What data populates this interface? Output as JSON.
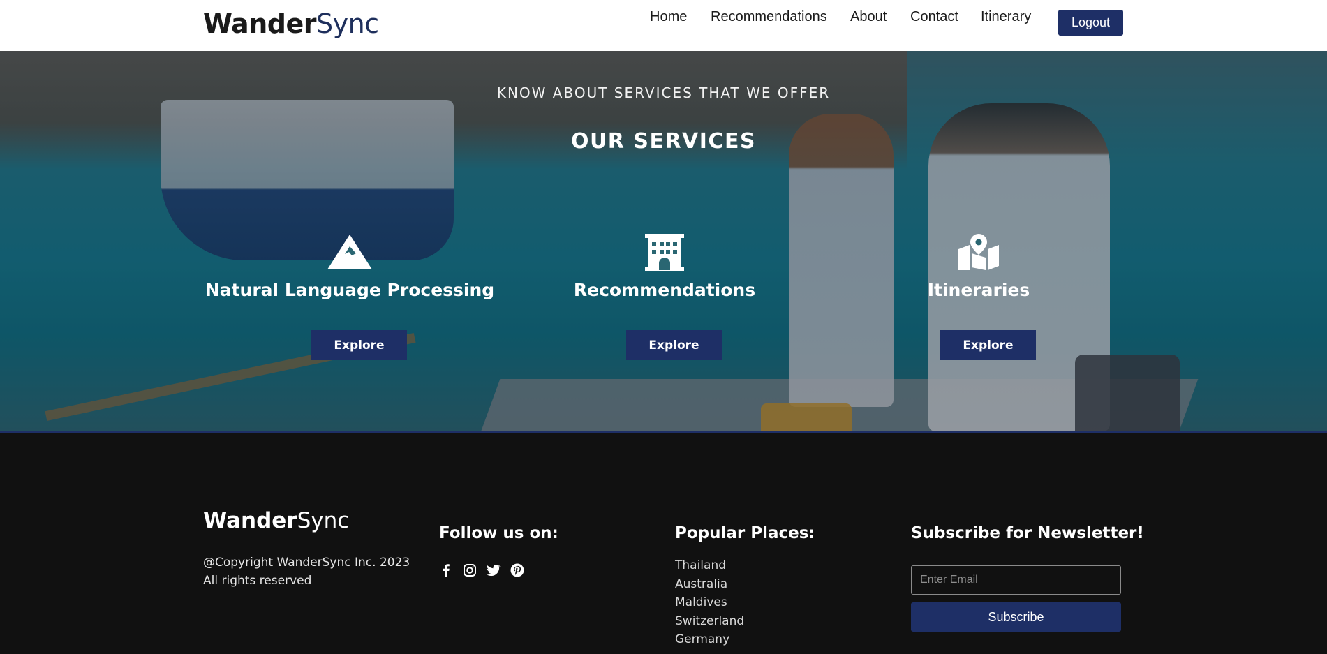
{
  "header": {
    "logo_part1": "Wander",
    "logo_part2": "Sync",
    "nav": [
      "Home",
      "Recommendations",
      "About",
      "Contact",
      "Itinerary"
    ],
    "logout_label": "Logout"
  },
  "hero": {
    "subtitle": "KNOW ABOUT SERVICES THAT WE OFFER",
    "title": "OUR SERVICES",
    "services": [
      {
        "icon": "mountain-icon",
        "title": "Natural Language Processing",
        "button": "Explore"
      },
      {
        "icon": "hotel-building-icon",
        "title": "Recommendations",
        "button": "Explore"
      },
      {
        "icon": "map-pin-icon",
        "title": "Itineraries",
        "button": "Explore"
      }
    ]
  },
  "footer": {
    "logo_part1": "Wander",
    "logo_part2": "Sync",
    "copyright_line1": "@Copyright WanderSync Inc. 2023",
    "copyright_line2": "All rights reserved",
    "follow_heading": "Follow us on:",
    "social_icons": [
      "facebook-icon",
      "instagram-icon",
      "twitter-icon",
      "pinterest-icon"
    ],
    "places_heading": "Popular Places:",
    "places": [
      "Thailand",
      "Australia",
      "Maldives",
      "Switzerland",
      "Germany"
    ],
    "newsletter_heading": "Subscribe for Newsletter!",
    "email_placeholder": "Enter Email",
    "subscribe_label": "Subscribe"
  },
  "colors": {
    "accent": "#1e2f66",
    "footer_bg": "#111111",
    "header_bg": "#ffffff"
  }
}
